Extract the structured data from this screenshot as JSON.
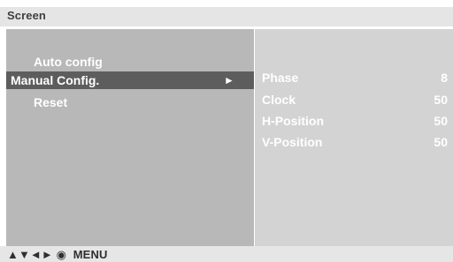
{
  "screen": {
    "title": "Screen"
  },
  "menu": {
    "items": [
      {
        "label": "Auto config"
      },
      {
        "label": "Manual Config.",
        "selected": true,
        "arrow": "►"
      },
      {
        "label": "Reset"
      }
    ]
  },
  "settings": {
    "rows": [
      {
        "name": "Phase",
        "value": "8"
      },
      {
        "name": "Clock",
        "value": "50"
      },
      {
        "name": "H-Position",
        "value": "50"
      },
      {
        "name": "V-Position",
        "value": "50"
      }
    ]
  },
  "footer": {
    "nav_icons": "▲▼◄► ◉",
    "menu_label": "MENU"
  },
  "colors": {
    "title_bar": "#e5e5e5",
    "left_pane": "#b8b8b8",
    "selected_row": "#5d5d5d",
    "right_pane": "#d3d3d3",
    "footer": "#e6e6e6"
  }
}
